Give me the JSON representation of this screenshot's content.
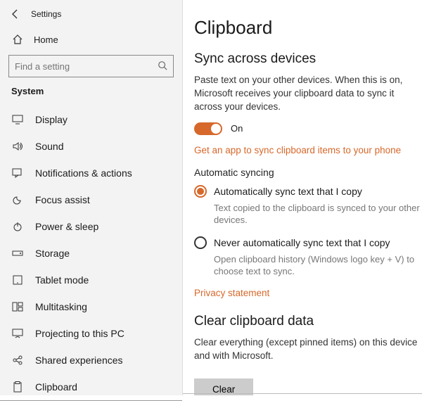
{
  "window": {
    "title": "Settings"
  },
  "sidebar": {
    "home": "Home",
    "search_placeholder": "Find a setting",
    "section": "System",
    "items": [
      {
        "label": "Display"
      },
      {
        "label": "Sound"
      },
      {
        "label": "Notifications & actions"
      },
      {
        "label": "Focus assist"
      },
      {
        "label": "Power & sleep"
      },
      {
        "label": "Storage"
      },
      {
        "label": "Tablet mode"
      },
      {
        "label": "Multitasking"
      },
      {
        "label": "Projecting to this PC"
      },
      {
        "label": "Shared experiences"
      },
      {
        "label": "Clipboard"
      }
    ]
  },
  "main": {
    "title": "Clipboard",
    "sync": {
      "heading": "Sync across devices",
      "desc": "Paste text on your other devices. When this is on, Microsoft receives your clipboard data to sync it across your devices.",
      "toggle_label": "On",
      "link": "Get an app to sync clipboard items to your phone",
      "auto_heading": "Automatic syncing",
      "option1": {
        "label": "Automatically sync text that I copy",
        "desc": "Text copied to the clipboard is synced to your other devices."
      },
      "option2": {
        "label": "Never automatically sync text that I copy",
        "desc": "Open clipboard history (Windows logo key + V) to choose text to sync."
      },
      "privacy": "Privacy statement"
    },
    "clear": {
      "heading": "Clear clipboard data",
      "desc": "Clear everything (except pinned items) on this device and with Microsoft.",
      "button": "Clear"
    }
  }
}
